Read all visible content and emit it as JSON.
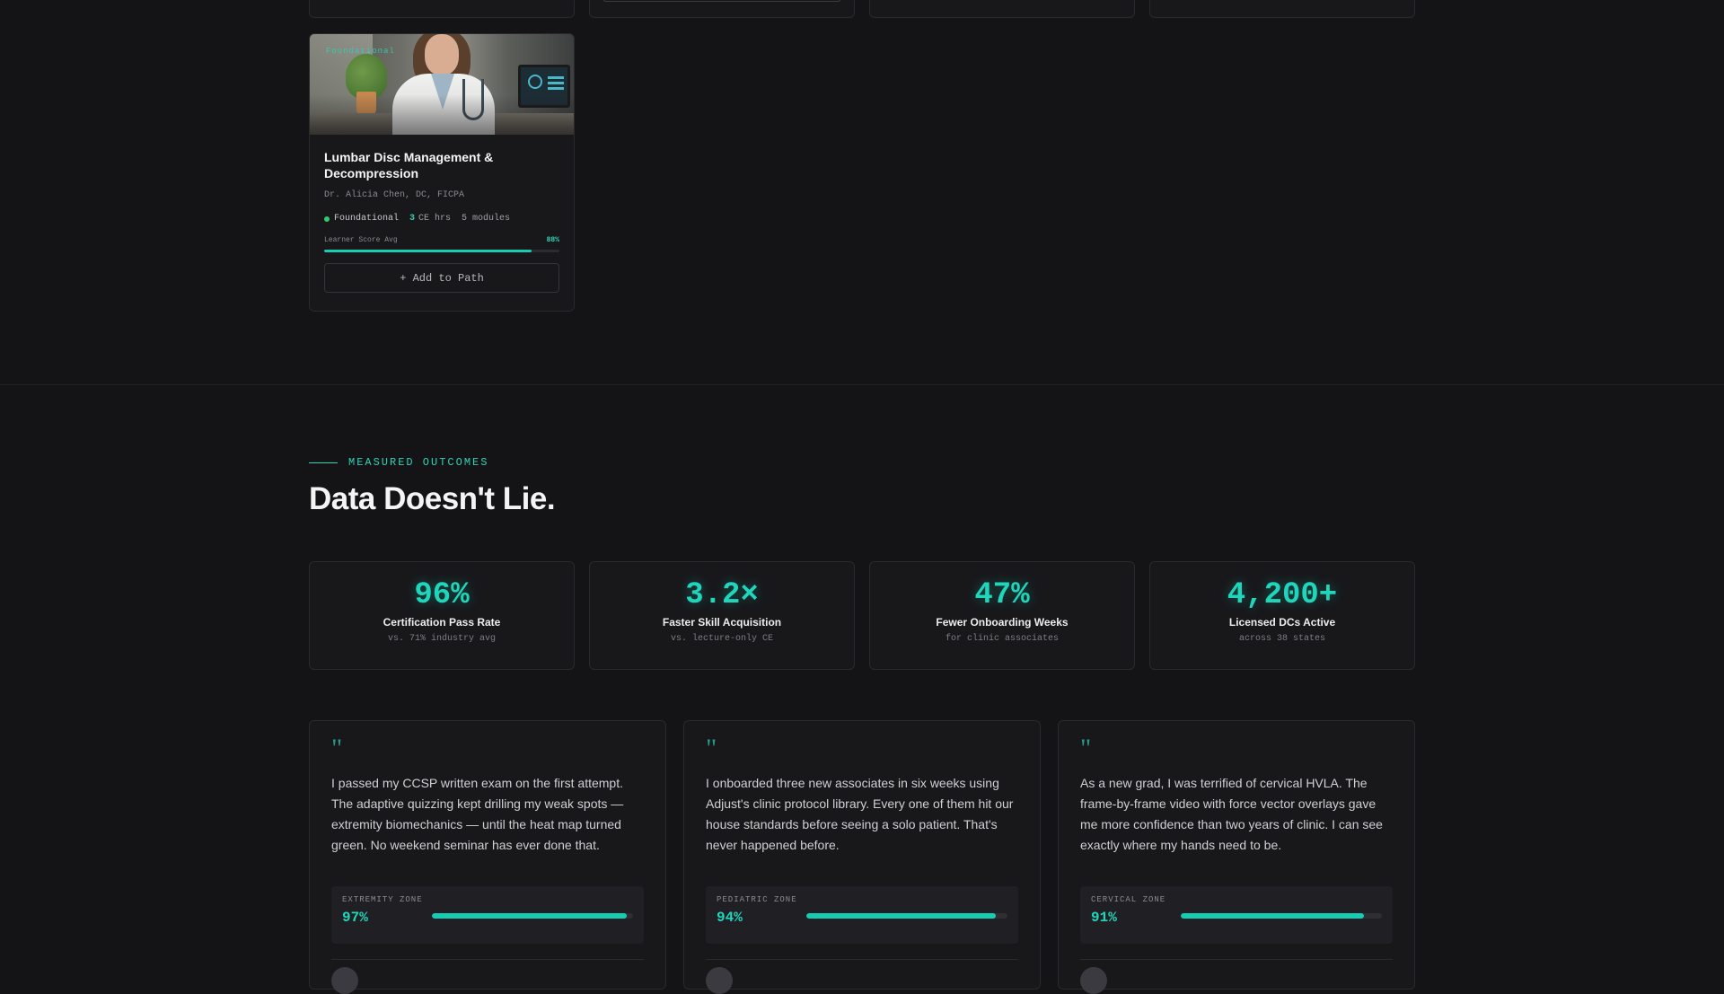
{
  "course": {
    "image_badge": "Foundational",
    "title": "Lumbar Disc Management & Decompression",
    "author": "Dr. Alicia Chen, DC, FICPA",
    "level": "Foundational",
    "ce_hours": "3",
    "ce_label": "CE hrs",
    "modules": "5 modules",
    "score_label": "Learner Score Avg",
    "score_pct": "88%",
    "score_value": 0.88,
    "add_button": "+ Add to Path"
  },
  "outcomes": {
    "eyebrow": "MEASURED OUTCOMES",
    "title": "Data Doesn't Lie.",
    "stats": [
      {
        "value": "96%",
        "label": "Certification Pass Rate",
        "sub": "vs. 71% industry avg"
      },
      {
        "value": "3.2×",
        "label": "Faster Skill Acquisition",
        "sub": "vs. lecture-only CE"
      },
      {
        "value": "47%",
        "label": "Fewer Onboarding Weeks",
        "sub": "for clinic associates"
      },
      {
        "value": "4,200+",
        "label": "Licensed DCs Active",
        "sub": "across 38 states"
      }
    ]
  },
  "testimonials": [
    {
      "quote_mark": "\"",
      "text": "I passed my CCSP written exam on the first attempt. The adaptive quizzing kept drilling my weak spots — extremity biomechanics — until the heat map turned green. No weekend seminar has ever done that.",
      "zone_label": "EXTREMITY ZONE",
      "zone_pct": "97%",
      "zone_value": 0.97
    },
    {
      "quote_mark": "\"",
      "text": "I onboarded three new associates in six weeks using Adjust's clinic protocol library. Every one of them hit our house standards before seeing a solo patient. That's never happened before.",
      "zone_label": "PEDIATRIC ZONE",
      "zone_pct": "94%",
      "zone_value": 0.94
    },
    {
      "quote_mark": "\"",
      "text": "As a new grad, I was terrified of cervical HVLA. The frame-by-frame video with force vector overlays gave me more confidence than two years of clinic. I can see exactly where my hands need to be.",
      "zone_label": "CERVICAL ZONE",
      "zone_pct": "91%",
      "zone_value": 0.91
    }
  ],
  "colors": {
    "accent": "#1fd6bc",
    "background": "#141416",
    "card": "#18181b",
    "level_dot": "#2ecc71"
  }
}
